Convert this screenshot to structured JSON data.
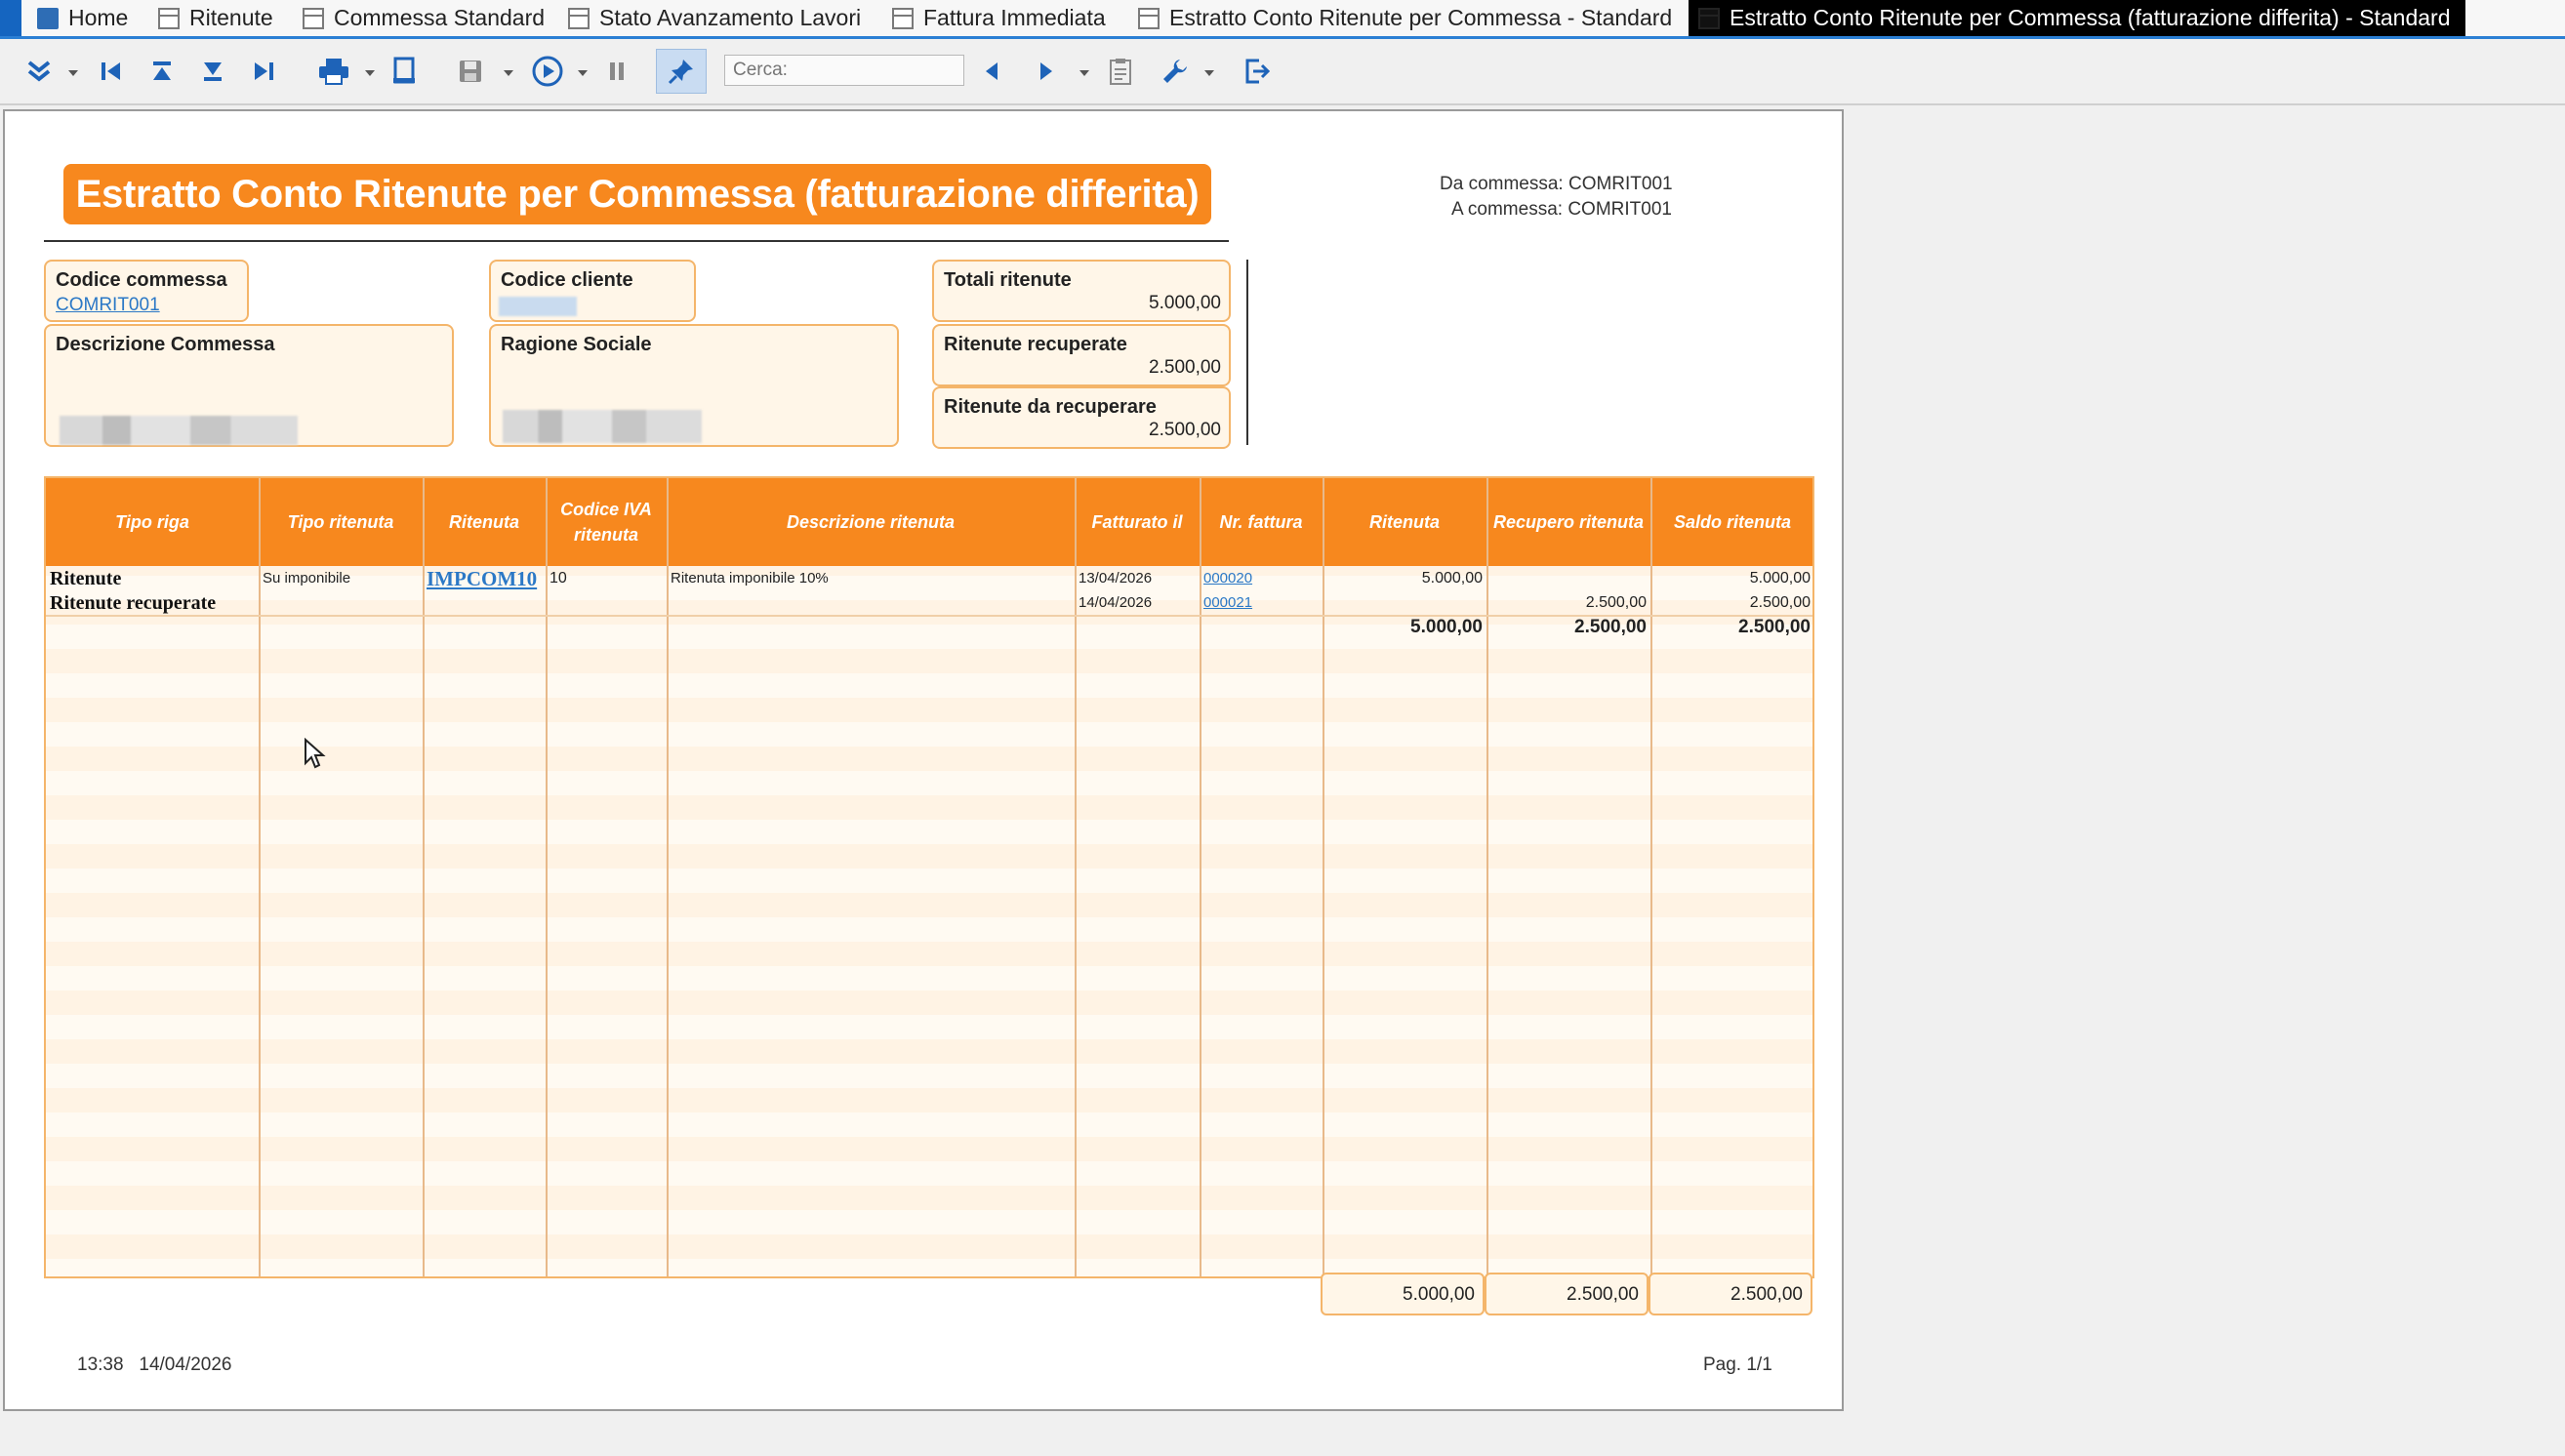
{
  "tabs": [
    {
      "label": "Home",
      "icon": "home-icon"
    },
    {
      "label": "Ritenute",
      "icon": "window-icon"
    },
    {
      "label": "Commessa Standard",
      "icon": "window-icon"
    },
    {
      "label": "Stato Avanzamento Lavori",
      "icon": "window-icon"
    },
    {
      "label": "Fattura Immediata",
      "icon": "window-icon"
    },
    {
      "label": "Estratto Conto Ritenute per Commessa - Standard",
      "icon": "report-icon"
    },
    {
      "label": "Estratto Conto Ritenute per Commessa (fatturazione differita) - Standard",
      "icon": "report-icon",
      "active": true
    }
  ],
  "toolbar": {
    "search_placeholder": "Cerca:",
    "icons": [
      "expand-all-icon",
      "first-page-icon",
      "page-top-icon",
      "page-bottom-icon",
      "last-page-icon",
      "print-icon",
      "export-icon",
      "save-icon",
      "play-icon",
      "pause-icon",
      "pin-icon",
      "find-previous-icon",
      "find-next-icon",
      "clipboard-icon",
      "wrench-icon",
      "exit-icon"
    ]
  },
  "report": {
    "title": "Estratto Conto Ritenute per Commessa (fatturazione differita)",
    "range": {
      "from_label": "Da commessa:",
      "from_value": "COMRIT001",
      "to_label": "A commessa:",
      "to_value": "COMRIT001"
    },
    "codice_commessa": {
      "label": "Codice commessa",
      "value": "COMRIT001"
    },
    "codice_cliente": {
      "label": "Codice cliente"
    },
    "descrizione_commessa": {
      "label": "Descrizione Commessa"
    },
    "ragione_sociale": {
      "label": "Ragione Sociale"
    },
    "totali_ritenute": {
      "label": "Totali ritenute",
      "value": "5.000,00"
    },
    "ritenute_recuperate": {
      "label": "Ritenute recuperate",
      "value": "2.500,00"
    },
    "ritenute_da_recuperare": {
      "label": "Ritenute da recuperare",
      "value": "2.500,00"
    },
    "columns": [
      "Tipo riga",
      "Tipo ritenuta",
      "Ritenuta",
      "Codice IVA ritenuta",
      "Descrizione ritenuta",
      "Fatturato il",
      "Nr. fattura",
      "Ritenuta",
      "Recupero ritenuta",
      "Saldo ritenuta"
    ],
    "rows": [
      {
        "tipo_riga": "Ritenute",
        "tipo_ritenuta": "Su imponibile",
        "ritenuta": "IMPCOM10",
        "codice_iva": "10",
        "descrizione": "Ritenuta imponibile 10%",
        "fatturato_il": "13/04/2026",
        "nr_fattura": "000020",
        "importo": "5.000,00",
        "recupero": "",
        "saldo": "5.000,00"
      },
      {
        "tipo_riga": "Ritenute recuperate",
        "tipo_ritenuta": "",
        "ritenuta": "",
        "codice_iva": "",
        "descrizione": "",
        "fatturato_il": "14/04/2026",
        "nr_fattura": "000021",
        "importo": "",
        "recupero": "2.500,00",
        "saldo": "2.500,00"
      }
    ],
    "group_totals": {
      "importo": "5.000,00",
      "recupero": "2.500,00",
      "saldo": "2.500,00"
    },
    "grand_totals": {
      "importo": "5.000,00",
      "recupero": "2.500,00",
      "saldo": "2.500,00"
    },
    "footer": {
      "time": "13:38",
      "date": "14/04/2026",
      "page": "Pag. 1/1"
    }
  },
  "colors": {
    "accent": "#f7881e",
    "box_fill": "#fff6e8",
    "box_border": "#f4b56a",
    "link": "#2b78c6",
    "tab_active_bg": "#000000"
  }
}
